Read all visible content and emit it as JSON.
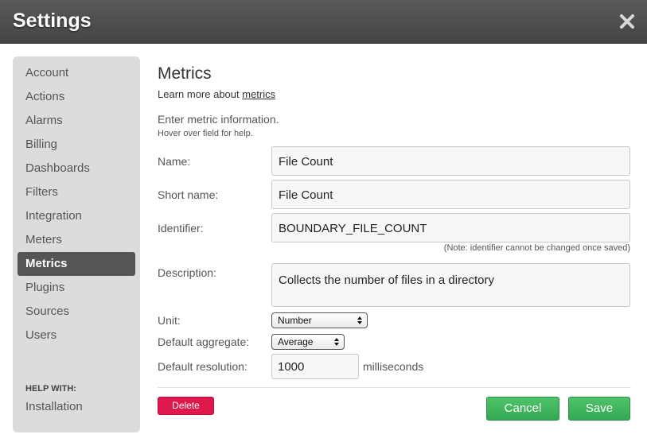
{
  "window": {
    "title": "Settings",
    "close_icon": "close-icon"
  },
  "sidebar": {
    "items": [
      {
        "label": "Account",
        "active": false
      },
      {
        "label": "Actions",
        "active": false
      },
      {
        "label": "Alarms",
        "active": false
      },
      {
        "label": "Billing",
        "active": false
      },
      {
        "label": "Dashboards",
        "active": false
      },
      {
        "label": "Filters",
        "active": false
      },
      {
        "label": "Integration",
        "active": false
      },
      {
        "label": "Meters",
        "active": false
      },
      {
        "label": "Metrics",
        "active": true
      },
      {
        "label": "Plugins",
        "active": false
      },
      {
        "label": "Sources",
        "active": false
      },
      {
        "label": "Users",
        "active": false
      }
    ],
    "help_heading": "HELP WITH:",
    "help_links": [
      {
        "label": "Installation"
      }
    ]
  },
  "main": {
    "title": "Metrics",
    "learn_more_prefix": "Learn more about ",
    "learn_more_link": "metrics",
    "intro": "Enter metric information.",
    "hover_help": "Hover over field for help.",
    "form": {
      "name": {
        "label": "Name:",
        "value": "File Count"
      },
      "short_name": {
        "label": "Short name:",
        "value": "File Count"
      },
      "identifier": {
        "label": "Identifier:",
        "value": "BOUNDARY_FILE_COUNT",
        "note": "(Note: identifier cannot be changed once saved)"
      },
      "description": {
        "label": "Description:",
        "value": "Collects the number of files in a directory"
      },
      "unit": {
        "label": "Unit:",
        "value": "Number"
      },
      "aggregate": {
        "label": "Default aggregate:",
        "value": "Average"
      },
      "resolution": {
        "label": "Default resolution:",
        "value": "1000",
        "units": "milliseconds"
      }
    },
    "buttons": {
      "delete": "Delete",
      "cancel": "Cancel",
      "save": "Save"
    }
  },
  "colors": {
    "title_bar": "#4a4a4a",
    "sidebar_bg": "#dcdcdc",
    "active_item_bg": "#555555",
    "delete_button": "#e0174b",
    "primary_green": "#3db35b"
  }
}
